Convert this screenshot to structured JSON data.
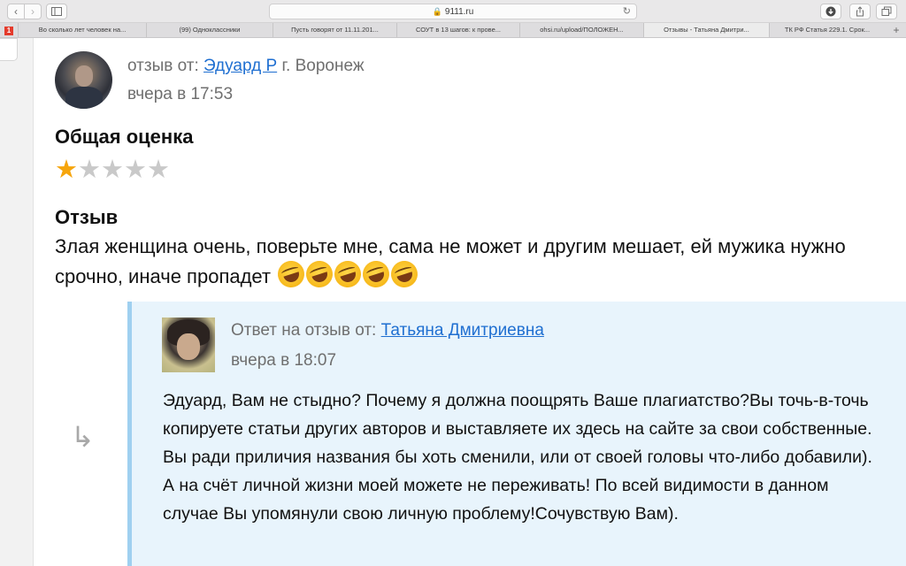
{
  "browser": {
    "url": "9111.ru",
    "back_icon": "chevron-left-icon",
    "forward_icon": "chevron-right-icon",
    "tabs": [
      {
        "label": "Во сколько лет человек на...",
        "active": false
      },
      {
        "label": "(99) Одноклассники",
        "active": false
      },
      {
        "label": "Пусть говорят от 11.11.201...",
        "active": false
      },
      {
        "label": "СОУТ в 13 шагов: к прове...",
        "active": false
      },
      {
        "label": "ohsi.ru/upload/ПОЛОЖЕН...",
        "active": false
      },
      {
        "label": "Отзывы - Татьяна Дмитри...",
        "active": true
      },
      {
        "label": "ТК РФ Статья 229.1. Срок...",
        "active": false
      }
    ],
    "pinned_badge": "1",
    "add_tab": "+"
  },
  "review": {
    "from_label": "отзыв от:",
    "author": "Эдуард Р",
    "city": "г. Воронеж",
    "time": "вчера в 17:53",
    "rating_heading": "Общая оценка",
    "rating": 1,
    "rating_max": 5,
    "review_heading": "Отзыв",
    "text": "Злая женщина очень, поверьте мне, сама не может и другим мешает, ей мужика нужно срочно, иначе пропадет",
    "emoji_count": 5
  },
  "reply": {
    "from_label": "Ответ на отзыв от:",
    "author": "Татьяна Дмитриевна",
    "time": "вчера в 18:07",
    "text": "Эдуард, Вам не стыдно? Почему я должна поощрять Ваше плагиатство?Вы точь-в-точь копируете статьи других авторов и выставляете их здесь на сайте за свои собственные. Вы ради приличия названия бы хоть сменили, или от своей головы что-либо добавили). А на счёт личной жизни моей можете не переживать! По всей видимости в данном случае Вы упомянули свою личную проблему!Сочувствую Вам).",
    "arrow_glyph": "↳"
  },
  "colors": {
    "star_filled": "#f6a50c",
    "star_empty": "#c9c9c9",
    "link": "#1f6fd1",
    "reply_bg": "#e8f4fc",
    "reply_border": "#9fd0f0"
  }
}
